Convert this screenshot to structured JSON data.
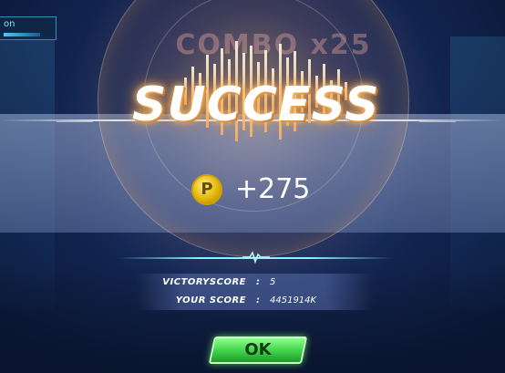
{
  "hud": {
    "top_left_text": "on"
  },
  "combo_text": "COMBO x25",
  "result": {
    "title": "SUCCESS",
    "coin_symbol": "P",
    "reward": "+275"
  },
  "stats": [
    {
      "label": "VICTORYSCORE",
      "separator": ":",
      "value": "5"
    },
    {
      "label": "YOUR SCORE",
      "separator": ":",
      "value": "4451914K"
    }
  ],
  "ok_button": {
    "label": "OK"
  },
  "colors": {
    "success_glow": "#ff9a3a",
    "coin": "#e0b000",
    "ok_button": "#3fd04a",
    "divider": "#8ef0ff"
  }
}
